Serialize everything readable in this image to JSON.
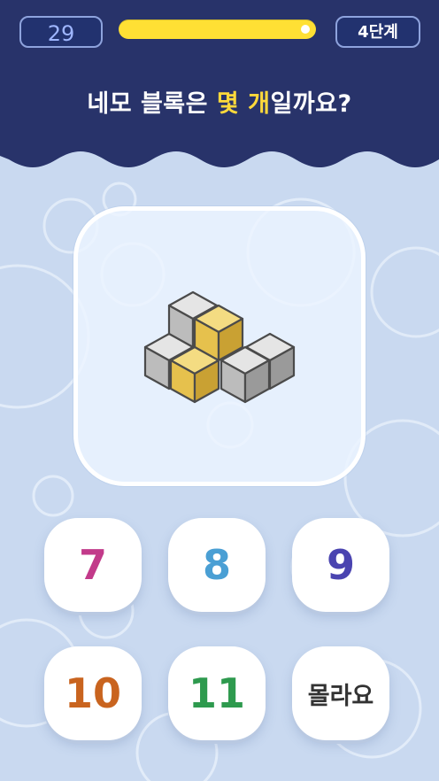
{
  "header": {
    "score": "29",
    "progress_fraction": 0.97,
    "level_label": "4단계"
  },
  "question": {
    "part1": "네모 블록은 ",
    "highlight1": "몇 개",
    "part2": "일까요?"
  },
  "colors": {
    "header_bg": "#28336a",
    "accent_yellow": "#ffe034",
    "background": "#c9d9f0"
  },
  "puzzle": {
    "description_icons": [
      "gray-cube",
      "yellow-cube"
    ]
  },
  "answers": [
    {
      "label": "7",
      "color": "#c23a8a"
    },
    {
      "label": "8",
      "color": "#4a9fd4"
    },
    {
      "label": "9",
      "color": "#4a44b0"
    },
    {
      "label": "10",
      "color": "#c9641f"
    },
    {
      "label": "11",
      "color": "#2e9a4e"
    },
    {
      "label": "몰라요",
      "color": "#333333"
    }
  ]
}
